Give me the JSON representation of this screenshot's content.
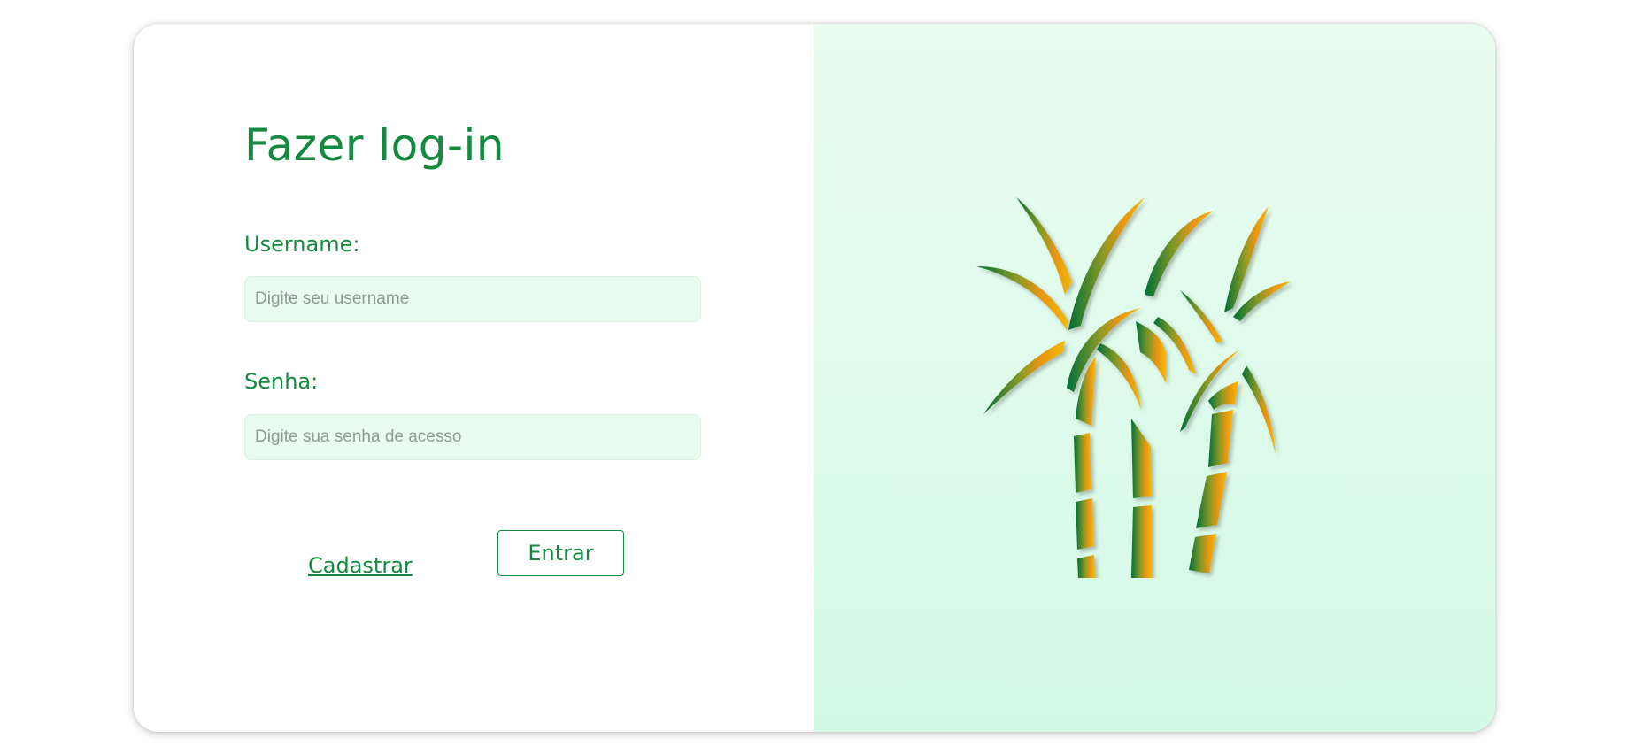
{
  "login": {
    "title": "Fazer log-in",
    "username_label": "Username:",
    "username_placeholder": "Digite seu username",
    "username_value": "",
    "password_label": "Senha:",
    "password_placeholder": "Digite sua senha de acesso",
    "password_value": "",
    "register_link": "Cadastrar",
    "submit_button": "Entrar"
  },
  "colors": {
    "accent": "#138a3f",
    "input_bg": "#eafcf1",
    "panel_bg_top": "#e8fcf0",
    "panel_bg_bottom": "#d4fae5"
  },
  "illustration": {
    "icon": "sugarcane-logo-icon"
  }
}
